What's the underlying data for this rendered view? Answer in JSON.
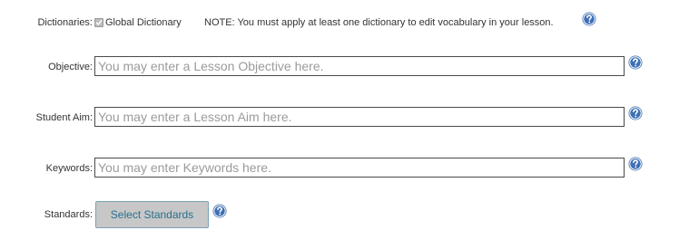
{
  "dictionaries": {
    "label": "Dictionaries:",
    "global_dictionary_label": "Global Dictionary",
    "global_dictionary_checked": true,
    "note": "NOTE: You must apply at least one dictionary to edit vocabulary in your lesson."
  },
  "objective": {
    "label": "Objective:",
    "value": "",
    "placeholder": "You may enter a Lesson Objective here."
  },
  "student_aim": {
    "label": "Student Aim:",
    "value": "",
    "placeholder": "You may enter a Lesson Aim here."
  },
  "keywords": {
    "label": "Keywords:",
    "value": "",
    "placeholder": "You may enter Keywords here."
  },
  "standards": {
    "label": "Standards:",
    "button_label": "Select Standards"
  },
  "icons": {
    "help": "question-circle-icon",
    "checkbox": "checkmark-icon"
  },
  "colors": {
    "help_icon": "#3d6fb5",
    "button_text": "#2a6f8f",
    "button_bg": "#c7c7c7",
    "placeholder": "#9b9b9b"
  }
}
